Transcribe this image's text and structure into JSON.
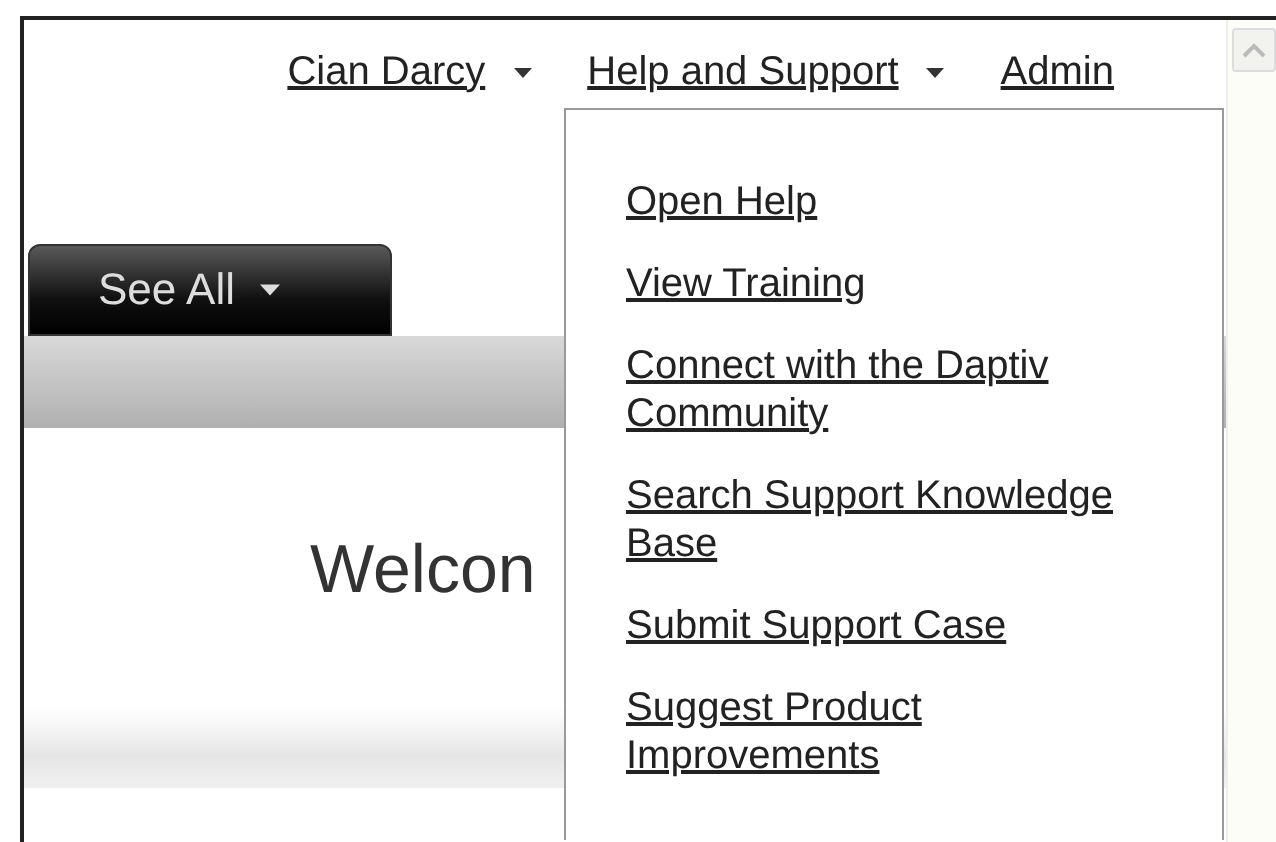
{
  "top_nav": [
    {
      "label": "Cian Darcy",
      "has_menu": true
    },
    {
      "label": "Help and Support",
      "has_menu": true
    },
    {
      "label": "Admin",
      "has_menu": false
    }
  ],
  "help_menu": {
    "items": [
      "Open Help",
      "View Training",
      "Connect with the Daptiv Community",
      "Search Support Knowledge Base",
      "Submit Support Case",
      "Suggest Product Improvements"
    ]
  },
  "see_all_tab": {
    "label": "See All"
  },
  "welcome": {
    "heading": "Welcon"
  }
}
